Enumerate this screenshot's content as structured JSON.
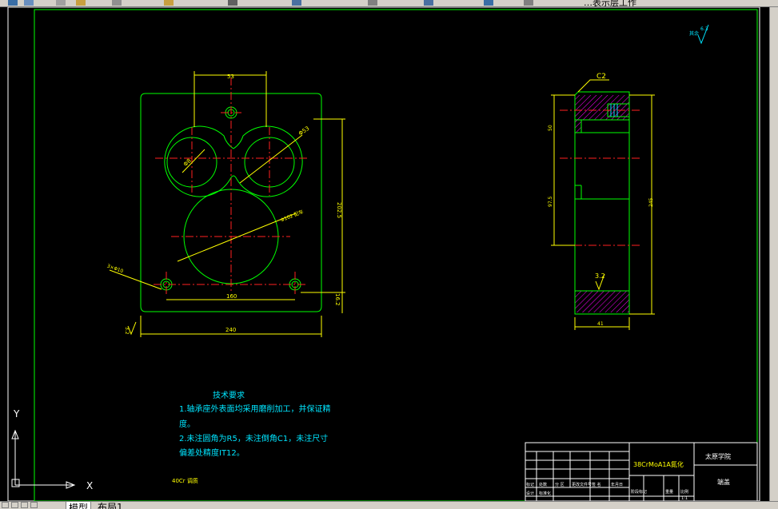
{
  "toolbar": {
    "visible_text": "…表示层工作"
  },
  "drawing": {
    "front_view": {
      "dim_top": "53",
      "dim_small_hole": "Φ8",
      "dim_large_circle": "Φ53",
      "dim_center_hole": "Φ102 配车",
      "dim_hole_callout": "3×Φ10",
      "dim_hole_span": "160",
      "dim_right_height": "202.5",
      "dim_bottom_offset": "16.2",
      "dim_total_width": "240",
      "roughness_left": "3.2"
    },
    "side_view": {
      "chamfer": "C2",
      "dim_top_section": "50",
      "dim_mid_section": "97.5",
      "dim_overall_height": "245",
      "dim_width": "41",
      "roughness": "3.2"
    },
    "roughness_corner": {
      "prefix": "其余",
      "value": "6.3"
    },
    "tech_notes": {
      "heading": "技术要求",
      "line1": "1.轴承座外表面均采用磨削加工，并保证精",
      "line2": "度。",
      "line3": "2.未注圆角为R5，未注倒角C1，未注尺寸",
      "line4": "偏差处精度IT12。"
    },
    "material_note": "40Cr 调质",
    "title_block": {
      "material": "38CrMoA1A氮化",
      "school": "太原学院",
      "drawing_name": "端盖",
      "headers": [
        "标记",
        "处数",
        "分 区",
        "更改文件号",
        "签 名",
        "年月日"
      ],
      "row2": [
        "设计",
        "标准化",
        "",
        "阶段标记",
        "重量",
        "比例"
      ],
      "scale": "1:1"
    },
    "ucs": {
      "y_label": "Y",
      "x_label": "X"
    }
  },
  "tabs": {
    "model": "模型",
    "layout1": "布局1"
  }
}
